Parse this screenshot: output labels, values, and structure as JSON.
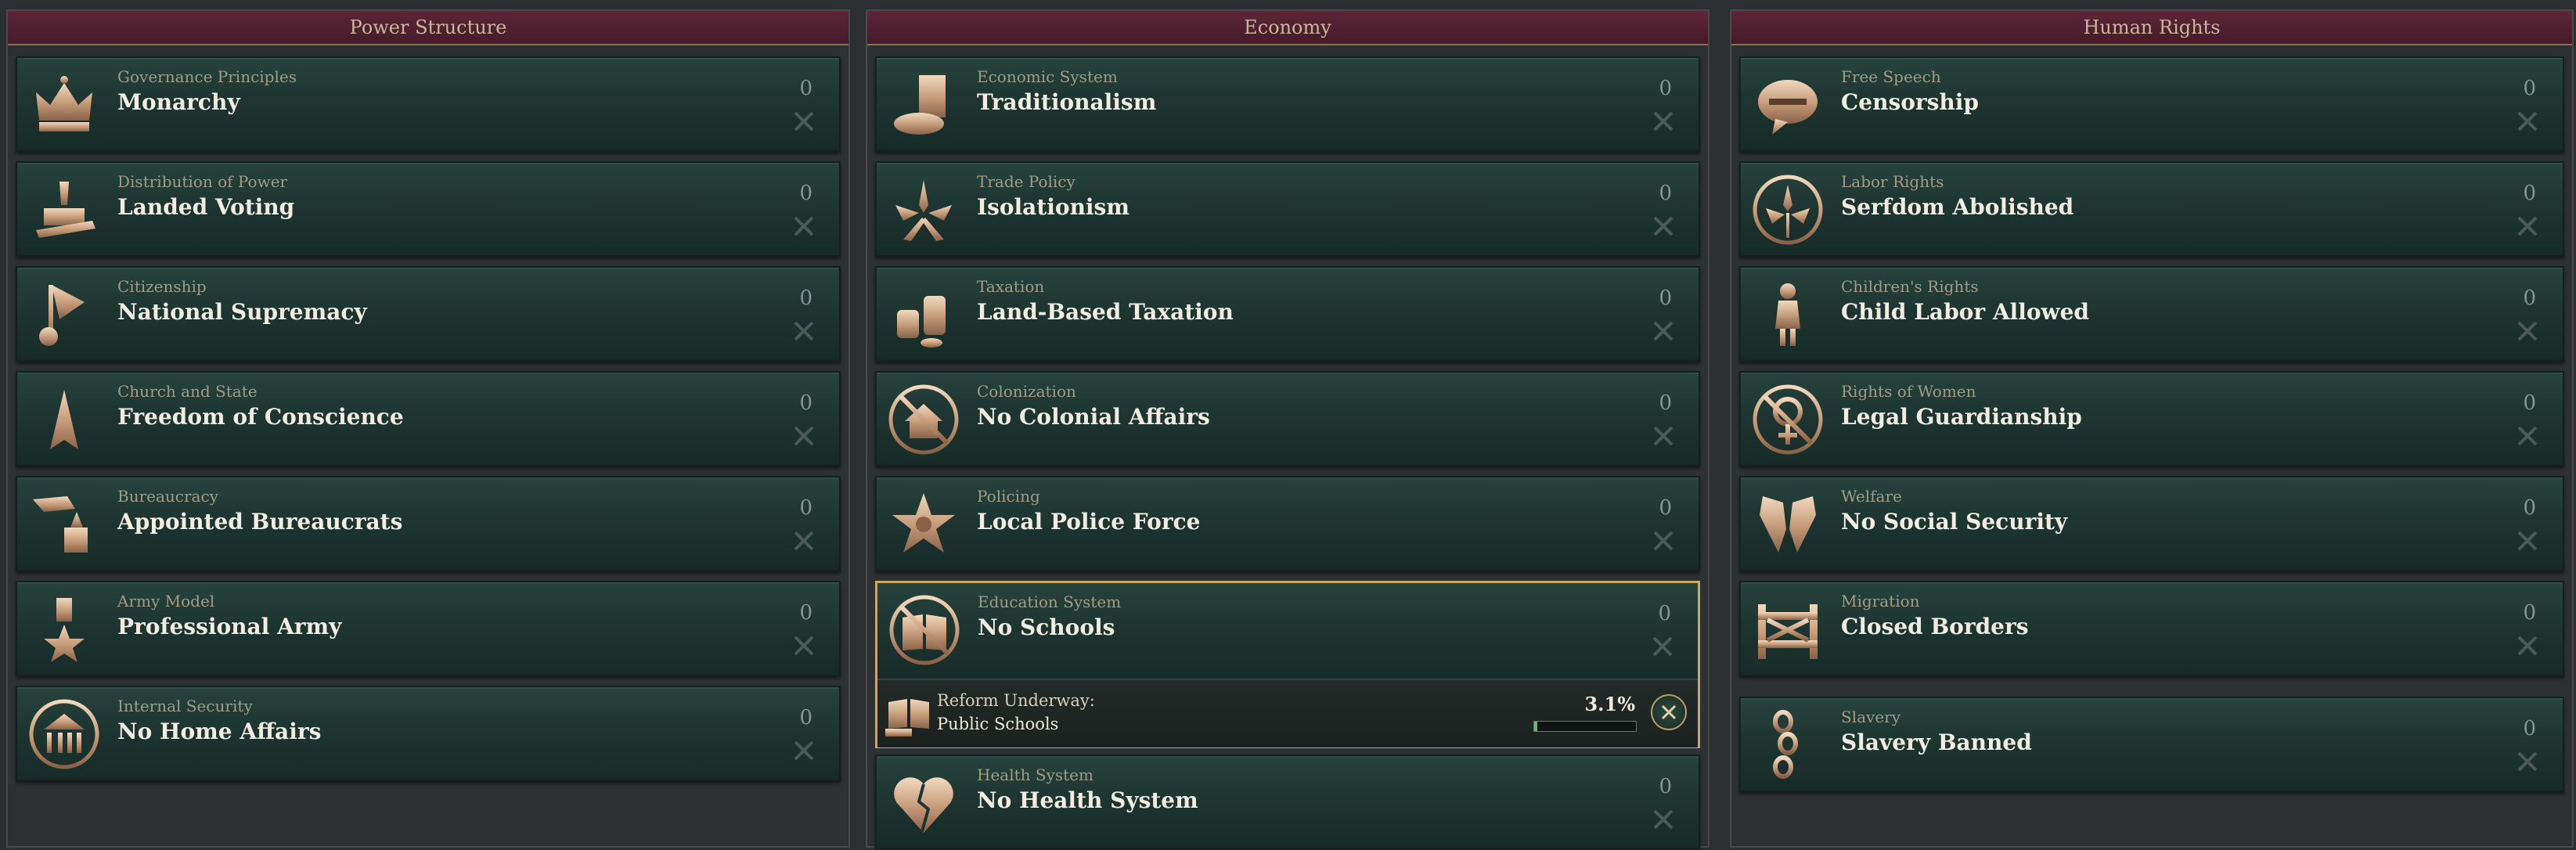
{
  "panels": [
    {
      "title": "Power Structure",
      "laws": [
        {
          "category": "Governance Principles",
          "name": "Monarchy",
          "count": "0",
          "icon": "crown-icon"
        },
        {
          "category": "Distribution of Power",
          "name": "Landed Voting",
          "count": "0",
          "icon": "ballot-hand-icon"
        },
        {
          "category": "Citizenship",
          "name": "National Supremacy",
          "count": "0",
          "icon": "flag-fist-icon"
        },
        {
          "category": "Church and State",
          "name": "Freedom of Conscience",
          "count": "0",
          "icon": "praying-hands-icon"
        },
        {
          "category": "Bureaucracy",
          "name": "Appointed Bureaucrats",
          "count": "0",
          "icon": "quill-stamp-icon"
        },
        {
          "category": "Army Model",
          "name": "Professional Army",
          "count": "0",
          "icon": "medal-icon"
        },
        {
          "category": "Internal Security",
          "name": "No Home Affairs",
          "count": "0",
          "icon": "building-icon"
        }
      ]
    },
    {
      "title": "Economy",
      "laws": [
        {
          "category": "Economic System",
          "name": "Traditionalism",
          "count": "0",
          "icon": "bread-icon"
        },
        {
          "category": "Trade Policy",
          "name": "Isolationism",
          "count": "0",
          "icon": "wheat-arrows-icon"
        },
        {
          "category": "Taxation",
          "name": "Land-Based Taxation",
          "count": "0",
          "icon": "coins-icon"
        },
        {
          "category": "Colonization",
          "name": "No Colonial Affairs",
          "count": "0",
          "icon": "no-house-icon"
        },
        {
          "category": "Policing",
          "name": "Local Police Force",
          "count": "0",
          "icon": "sheriff-star-icon"
        },
        {
          "category": "Education System",
          "name": "No Schools",
          "count": "0",
          "icon": "no-book-icon"
        },
        {
          "category": "Health System",
          "name": "No Health System",
          "count": "0",
          "icon": "broken-heart-icon"
        }
      ],
      "reform": {
        "label": "Reform Underway:",
        "target": "Public Schools",
        "percent": "3.1%",
        "progress": 0.031
      }
    },
    {
      "title": "Human Rights",
      "laws": [
        {
          "category": "Free Speech",
          "name": "Censorship",
          "count": "0",
          "icon": "speech-bubble-icon"
        },
        {
          "category": "Labor Rights",
          "name": "Serfdom Abolished",
          "count": "0",
          "icon": "wheat-circle-icon"
        },
        {
          "category": "Children's Rights",
          "name": "Child Labor Allowed",
          "count": "0",
          "icon": "child-icon"
        },
        {
          "category": "Rights of Women",
          "name": "Legal Guardianship",
          "count": "0",
          "icon": "no-venus-icon"
        },
        {
          "category": "Welfare",
          "name": "No Social Security",
          "count": "0",
          "icon": "broken-hands-icon"
        },
        {
          "category": "Migration",
          "name": "Closed Borders",
          "count": "0",
          "icon": "barrier-icon"
        },
        {
          "category": "Slavery",
          "name": "Slavery Banned",
          "count": "0",
          "icon": "broken-chain-icon"
        }
      ]
    }
  ]
}
